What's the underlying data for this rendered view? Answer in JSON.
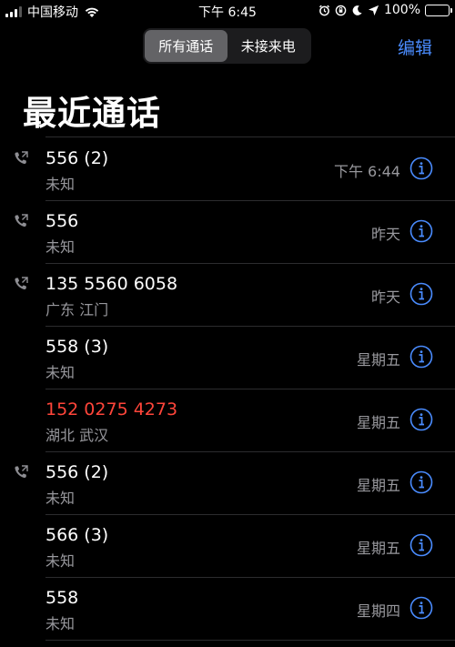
{
  "status_bar": {
    "carrier": "中国移动",
    "time": "下午 6:45",
    "battery": "100%"
  },
  "segments": [
    {
      "label": "所有通话",
      "active": true
    },
    {
      "label": "未接来电",
      "active": false
    }
  ],
  "edit_label": "编辑",
  "title": "最近通话",
  "accent_color": "#4a8cff",
  "missed_color": "#ff453a",
  "calls": [
    {
      "name": "556 (2)",
      "sub": "未知",
      "time": "下午 6:44",
      "outgoing": true,
      "missed": false
    },
    {
      "name": "556",
      "sub": "未知",
      "time": "昨天",
      "outgoing": true,
      "missed": false
    },
    {
      "name": "135 5560 6058",
      "sub": "广东 江门",
      "time": "昨天",
      "outgoing": true,
      "missed": false
    },
    {
      "name": "558 (3)",
      "sub": "未知",
      "time": "星期五",
      "outgoing": false,
      "missed": false
    },
    {
      "name": "152 0275 4273",
      "sub": "湖北 武汉",
      "time": "星期五",
      "outgoing": false,
      "missed": true
    },
    {
      "name": "556 (2)",
      "sub": "未知",
      "time": "星期五",
      "outgoing": true,
      "missed": false
    },
    {
      "name": "566 (3)",
      "sub": "未知",
      "time": "星期五",
      "outgoing": false,
      "missed": false
    },
    {
      "name": "558",
      "sub": "未知",
      "time": "星期四",
      "outgoing": false,
      "missed": false
    }
  ]
}
